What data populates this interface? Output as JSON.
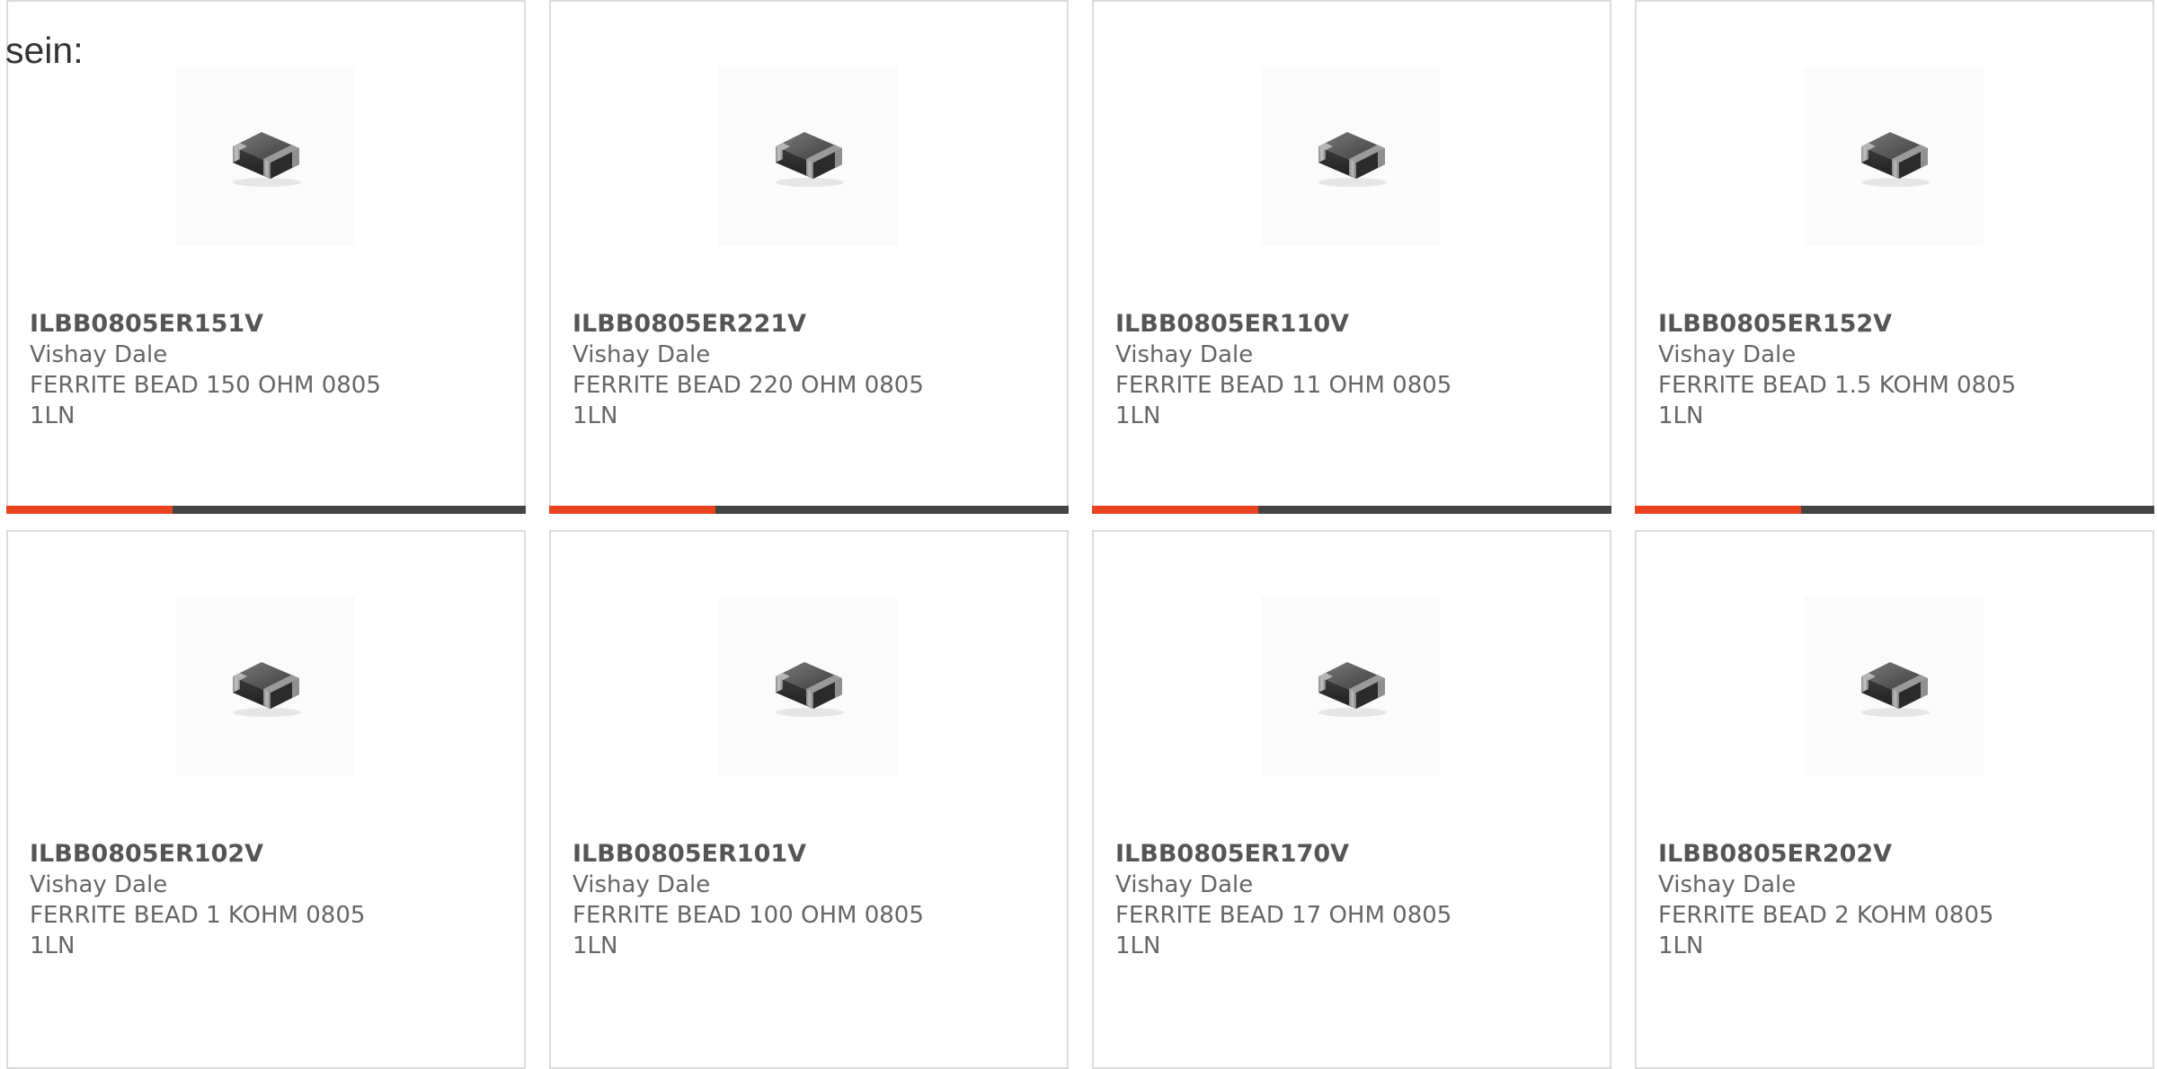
{
  "intro_text": "sein:",
  "accent_color": "#e8431d",
  "bar_color": "#444444",
  "products": [
    {
      "part_number": "ILBB0805ER151V",
      "manufacturer": "Vishay Dale",
      "description": "FERRITE BEAD 150 OHM 0805\n1LN",
      "image_icon": "ferrite-bead-chip-icon",
      "progress": 0.32
    },
    {
      "part_number": "ILBB0805ER221V",
      "manufacturer": "Vishay Dale",
      "description": "FERRITE BEAD 220 OHM 0805\n1LN",
      "image_icon": "ferrite-bead-chip-icon",
      "progress": 0.32
    },
    {
      "part_number": "ILBB0805ER110V",
      "manufacturer": "Vishay Dale",
      "description": "FERRITE BEAD 11 OHM 0805 1LN",
      "image_icon": "ferrite-bead-chip-icon",
      "progress": 0.32
    },
    {
      "part_number": "ILBB0805ER152V",
      "manufacturer": "Vishay Dale",
      "description": "FERRITE BEAD 1.5 KOHM 0805\n1LN",
      "image_icon": "ferrite-bead-chip-icon",
      "progress": 0.32
    },
    {
      "part_number": "ILBB0805ER102V",
      "manufacturer": "Vishay Dale",
      "description": "FERRITE BEAD 1 KOHM 0805 1LN",
      "image_icon": "ferrite-bead-chip-icon"
    },
    {
      "part_number": "ILBB0805ER101V",
      "manufacturer": "Vishay Dale",
      "description": "FERRITE BEAD 100 OHM 0805\n1LN",
      "image_icon": "ferrite-bead-chip-icon"
    },
    {
      "part_number": "ILBB0805ER170V",
      "manufacturer": "Vishay Dale",
      "description": "FERRITE BEAD 17 OHM 0805 1LN",
      "image_icon": "ferrite-bead-chip-icon"
    },
    {
      "part_number": "ILBB0805ER202V",
      "manufacturer": "Vishay Dale",
      "description": "FERRITE BEAD 2 KOHM 0805 1LN",
      "image_icon": "ferrite-bead-chip-icon"
    }
  ]
}
